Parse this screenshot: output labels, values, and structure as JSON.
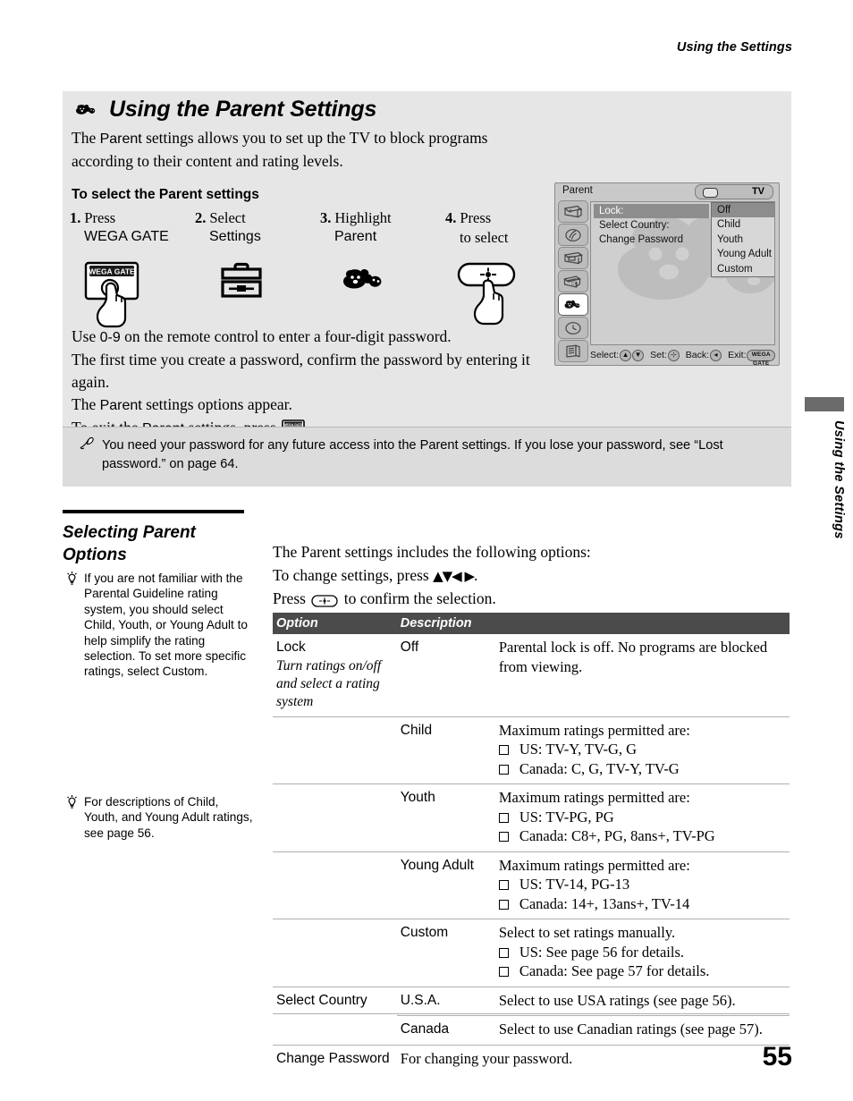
{
  "header": {
    "running_title": "Using the Settings"
  },
  "panel": {
    "icon": "parent-bear-icon",
    "title": "Using the Parent Settings",
    "intro_a": "The ",
    "intro_parent": "Parent",
    "intro_b": " settings allows you to set up the TV to block programs according to their content and rating levels.",
    "subhead": "To select the Parent settings",
    "steps": [
      {
        "num": "1.",
        "line1": "Press",
        "line2": "WEGA GATE",
        "art": "wega-gate-button-press-icon"
      },
      {
        "num": "2.",
        "line1": "Select",
        "line2": "Settings",
        "art": "toolbox-icon"
      },
      {
        "num": "3.",
        "line1": "Highlight",
        "line2": "Parent",
        "art": "parent-bear-icon"
      },
      {
        "num": "4.",
        "line1": "Press",
        "line2": "to select",
        "art": "select-button-press-icon"
      }
    ],
    "body": {
      "l1_a": "Use ",
      "l1_b": "0-9",
      "l1_c": " on the remote control to enter a four-digit password.",
      "l2": "The first time you create a password, confirm the password by entering it again.",
      "l3_a": "The ",
      "l3_b": "Parent",
      "l3_c": " settings options appear.",
      "l4_a": "To exit the ",
      "l4_b": "Parent",
      "l4_c": " settings, press",
      "l4_d": "."
    },
    "note": {
      "icon": "pencil-note-icon",
      "text": "You need your password for any future access into the Parent settings. If you lose your password, see “Lost password.” on page 64."
    }
  },
  "tv": {
    "menu_title": "Parent",
    "source_label": "TV",
    "sidebar_icons": [
      "video-icon",
      "audio-icon",
      "screen-icon",
      "channel-icon",
      "parent-icon",
      "clock-icon",
      "setup-icon"
    ],
    "selected_sidebar_index": 4,
    "menu_items": [
      "Lock:",
      "Select  Country:",
      "Change  Password"
    ],
    "selected_menu_index": 0,
    "dropdown_options": [
      "Off",
      "Child",
      "Youth",
      "Young Adult",
      "Custom"
    ],
    "selected_dropdown_index": 0,
    "footer": {
      "select_label": "Select:",
      "set_label": "Set:",
      "back_label": "Back:",
      "exit_label": "Exit:",
      "exit_key": "WEGA GATE"
    }
  },
  "side_tab": {
    "label": "Using the Settings"
  },
  "section": {
    "title_line1": "Selecting Parent",
    "title_line2": "Options",
    "tips": [
      {
        "icon": "lightbulb-tip-icon",
        "text": "If you are not familiar with the Parental Guideline rating system, you should select Child, Youth, or Young Adult to help simplify the rating selection. To set more specific ratings, select Custom."
      },
      {
        "icon": "lightbulb-tip-icon",
        "text": "For descriptions of Child, Youth, and Young Adult ratings, see page 56."
      }
    ],
    "lead": {
      "l1": "The Parent settings includes the following options:",
      "l2_a": "To change settings, press ",
      "l2_arrows": "▲▼◀ ▶",
      "l2_b": ".",
      "l3_a": "Press ",
      "l3_b": " to confirm the selection."
    }
  },
  "table": {
    "columns": [
      "Option",
      "Description"
    ],
    "rows": [
      {
        "option": "Lock",
        "option_sub": "Turn ratings on/off and select a rating system",
        "value": "Off",
        "desc": "Parental lock is off. No programs are blocked from viewing.",
        "bullets": []
      },
      {
        "option": "",
        "option_sub": "",
        "value": "Child",
        "desc": "Maximum ratings permitted are:",
        "bullets": [
          "US: TV-Y, TV-G, G",
          "Canada: C, G, TV-Y, TV-G"
        ]
      },
      {
        "option": "",
        "option_sub": "",
        "value": "Youth",
        "desc": "Maximum ratings permitted are:",
        "bullets": [
          "US: TV-PG, PG",
          "Canada: C8+, PG, 8ans+, TV-PG"
        ]
      },
      {
        "option": "",
        "option_sub": "",
        "value": "Young Adult",
        "desc": "Maximum ratings permitted are:",
        "bullets": [
          "US: TV-14, PG-13",
          "Canada: 14+, 13ans+, TV-14"
        ]
      },
      {
        "option": "",
        "option_sub": "",
        "value": "Custom",
        "desc": "Select to set ratings manually.",
        "bullets": [
          "US: See page 56 for details.",
          "Canada: See page 57 for details."
        ]
      },
      {
        "option": "Select Country",
        "option_sub": "",
        "value": "U.S.A.",
        "desc": "Select to use USA ratings (see page 56).",
        "bullets": []
      },
      {
        "option": "",
        "option_sub": "",
        "value": "Canada",
        "desc": "Select to use Canadian ratings (see page 57).",
        "bullets": []
      },
      {
        "option": "Change Password",
        "option_sub": "",
        "value": "",
        "desc": "For changing your password.",
        "bullets": []
      }
    ]
  },
  "footer": {
    "page_number": "55"
  }
}
